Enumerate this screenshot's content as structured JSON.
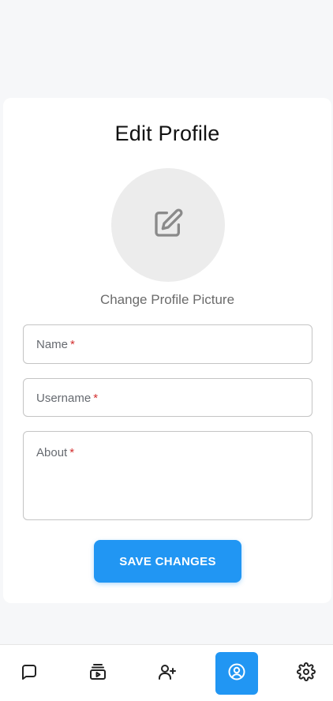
{
  "profile_form": {
    "title": "Edit Profile",
    "change_picture_label": "Change Profile Picture",
    "fields": {
      "name": {
        "label": "Name",
        "required_mark": "*",
        "value": ""
      },
      "username": {
        "label": "Username",
        "required_mark": "*",
        "value": ""
      },
      "about": {
        "label": "About",
        "required_mark": "*",
        "value": ""
      }
    },
    "save_label": "SAVE CHANGES"
  },
  "bottom_nav": {
    "items": [
      {
        "icon": "chat-bubble-icon",
        "active": false
      },
      {
        "icon": "video-stack-icon",
        "active": false
      },
      {
        "icon": "add-user-icon",
        "active": false
      },
      {
        "icon": "profile-circle-icon",
        "active": true
      },
      {
        "icon": "gear-icon",
        "active": false
      }
    ]
  },
  "colors": {
    "accent": "#2196f3",
    "background": "#f6f7f9",
    "card": "#ffffff",
    "required": "#d32f2f"
  }
}
